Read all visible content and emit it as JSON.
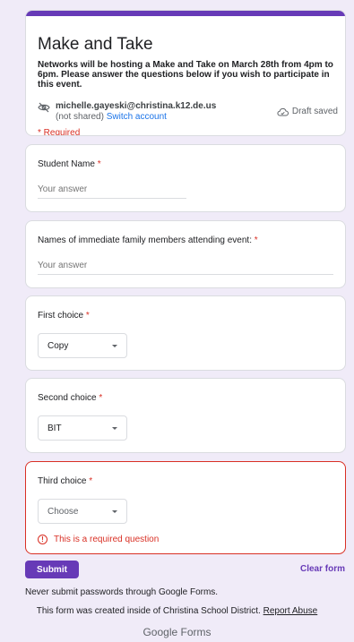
{
  "header": {
    "title": "Make and Take",
    "description": "Networks will be hosting a Make and Take on March 28th from 4pm to 6pm.  Please answer the questions below if you wish to participate in this event.",
    "account_email": "michelle.gayeski@christina.k12.de.us",
    "not_shared": "(not shared)",
    "switch_account": "Switch account",
    "draft_status": "Draft saved",
    "required_note": "* Required",
    "accent_color": "#673ab7"
  },
  "questions": [
    {
      "title": "Student Name",
      "required_mark": "*",
      "type": "short_text",
      "placeholder": "Your answer",
      "value": ""
    },
    {
      "title": "Names of immediate family members attending event:",
      "required_mark": "*",
      "type": "long_text",
      "placeholder": "Your answer",
      "value": ""
    },
    {
      "title": "First choice",
      "required_mark": "*",
      "type": "dropdown",
      "selected": "Copy"
    },
    {
      "title": "Second choice",
      "required_mark": "*",
      "type": "dropdown",
      "selected": "BIT"
    },
    {
      "title": "Third choice",
      "required_mark": "*",
      "type": "dropdown",
      "selected": "Choose",
      "error": "This is a required question"
    }
  ],
  "footer": {
    "submit": "Submit",
    "clear": "Clear form",
    "password_warning": "Never submit passwords through Google Forms.",
    "created_note": "This form was created inside of Christina School District.",
    "report_abuse": "Report Abuse",
    "brand_google": "Google",
    "brand_forms": "Forms"
  },
  "icons": {
    "eye_off": "eye-off-icon",
    "cloud": "cloud-done-icon",
    "caret": "caret-down-icon",
    "error": "error-icon"
  },
  "colors": {
    "background": "#f0ebf8",
    "error": "#d93025",
    "link": "#1a73e8"
  }
}
